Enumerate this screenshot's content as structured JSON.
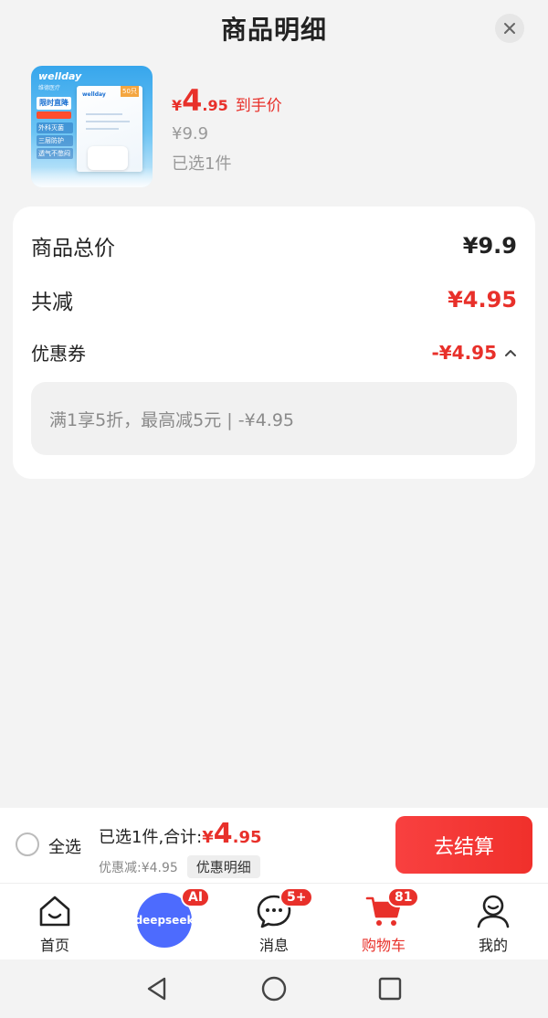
{
  "header": {
    "title": "商品明细"
  },
  "product": {
    "thumb_brand": "wellday",
    "thumb_brand_sub": "维德医疗",
    "thumb_tag": "限时直降",
    "thumb_features": [
      "外科灭菌",
      "三层防护",
      "透气不憋闷"
    ],
    "thumb_pack_count": "50只",
    "thumb_pack_logo": "wellday",
    "price_symbol": "¥",
    "price_int": "4",
    "price_dec": ".95",
    "price_tag": "到手价",
    "original_price": "¥9.9",
    "selected": "已选1件"
  },
  "summary": {
    "total_label": "商品总价",
    "total_value": "¥9.9",
    "reduce_label": "共减",
    "reduce_value": "¥4.95",
    "coupon_label": "优惠券",
    "coupon_value": "-¥4.95",
    "coupon_detail": "满1享5折，最高减5元 | -¥4.95"
  },
  "bottom_bar": {
    "select_all": "全选",
    "total_label": "已选1件,合计:",
    "total_symbol": "¥",
    "total_int": "4",
    "total_dec": ".95",
    "discount_text": "优惠减:¥4.95",
    "detail_button": "优惠明细",
    "checkout_button": "去结算"
  },
  "nav": {
    "items": [
      {
        "label": "首页",
        "icon": "home-icon"
      },
      {
        "label": "deepseek",
        "icon": "deepseek-icon",
        "badge": "AI"
      },
      {
        "label": "消息",
        "icon": "message-icon",
        "badge": "5+"
      },
      {
        "label": "购物车",
        "icon": "cart-icon",
        "badge": "81",
        "active": true
      },
      {
        "label": "我的",
        "icon": "profile-icon"
      }
    ]
  },
  "colors": {
    "accent": "#e8302a",
    "deepseek": "#4d6bfe"
  }
}
